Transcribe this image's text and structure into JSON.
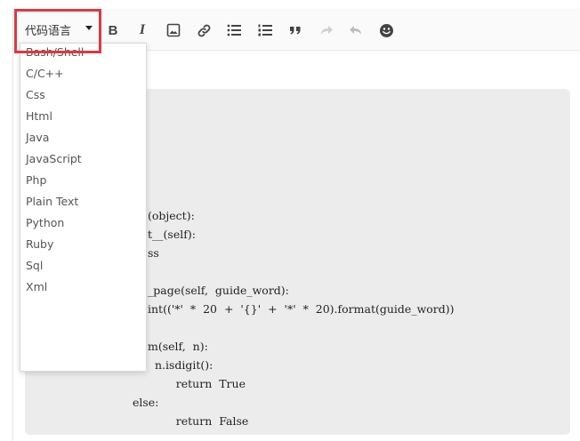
{
  "toolbar": {
    "language_select": {
      "label": "代码语言"
    },
    "buttons": {
      "bold": "B",
      "italic": "I"
    },
    "icons": [
      "bold-icon",
      "italic-icon",
      "image-icon",
      "link-icon",
      "bullet-list-icon",
      "ordered-list-icon",
      "quote-icon",
      "redo-icon",
      "undo-icon",
      "emoji-icon"
    ]
  },
  "dropdown": {
    "options": [
      "Bash/Shell",
      "C/C++",
      "Css",
      "Html",
      "Java",
      "JavaScript",
      "Php",
      "Plain Text",
      "Python",
      "Ruby",
      "Sql",
      "Xml"
    ]
  },
  "code": {
    "lines": [
      "(object):",
      "t__(self):",
      "ss",
      "",
      "_page(self,  guide_word):",
      "int(('*'  *  20  +  '{}'  +  '*'  *  20).format(guide_word))",
      "",
      "m(self,  n):",
      "  n.isdigit():",
      "        return  True",
      "else:",
      "        return  False"
    ]
  },
  "colors": {
    "highlight_border": "#e0383e",
    "code_background": "#ececec",
    "toolbar_background": "#fafafa"
  }
}
